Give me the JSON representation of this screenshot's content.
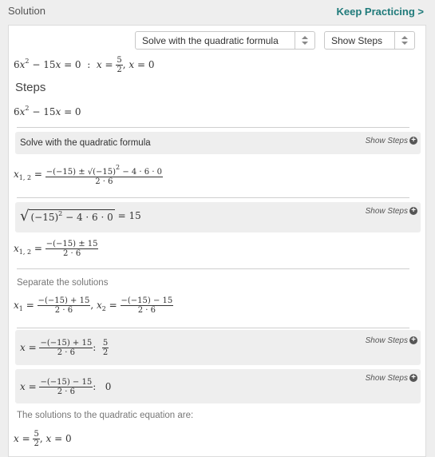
{
  "header": {
    "title": "Solution",
    "keep_practicing": "Keep Practicing >"
  },
  "controls": {
    "method_select": "Solve with the quadratic formula",
    "steps_select": "Show Steps"
  },
  "problem": {
    "equation": "6x² − 15x = 0",
    "separator": ":",
    "answer": "x = 5/2, x = 0"
  },
  "steps_heading": "Steps",
  "step_equation": "6x² − 15x = 0",
  "show_steps_label": "Show Steps",
  "sections": {
    "quadratic_formula": "Solve with the quadratic formula",
    "sqrt_value": "15",
    "separate": "Separate the solutions",
    "x1_value": "5/2",
    "x2_value": "0",
    "conclusion": "The solutions to the quadratic equation are:"
  },
  "colors": {
    "accent": "#1f7a7a",
    "box_bg": "#eeeeee"
  }
}
